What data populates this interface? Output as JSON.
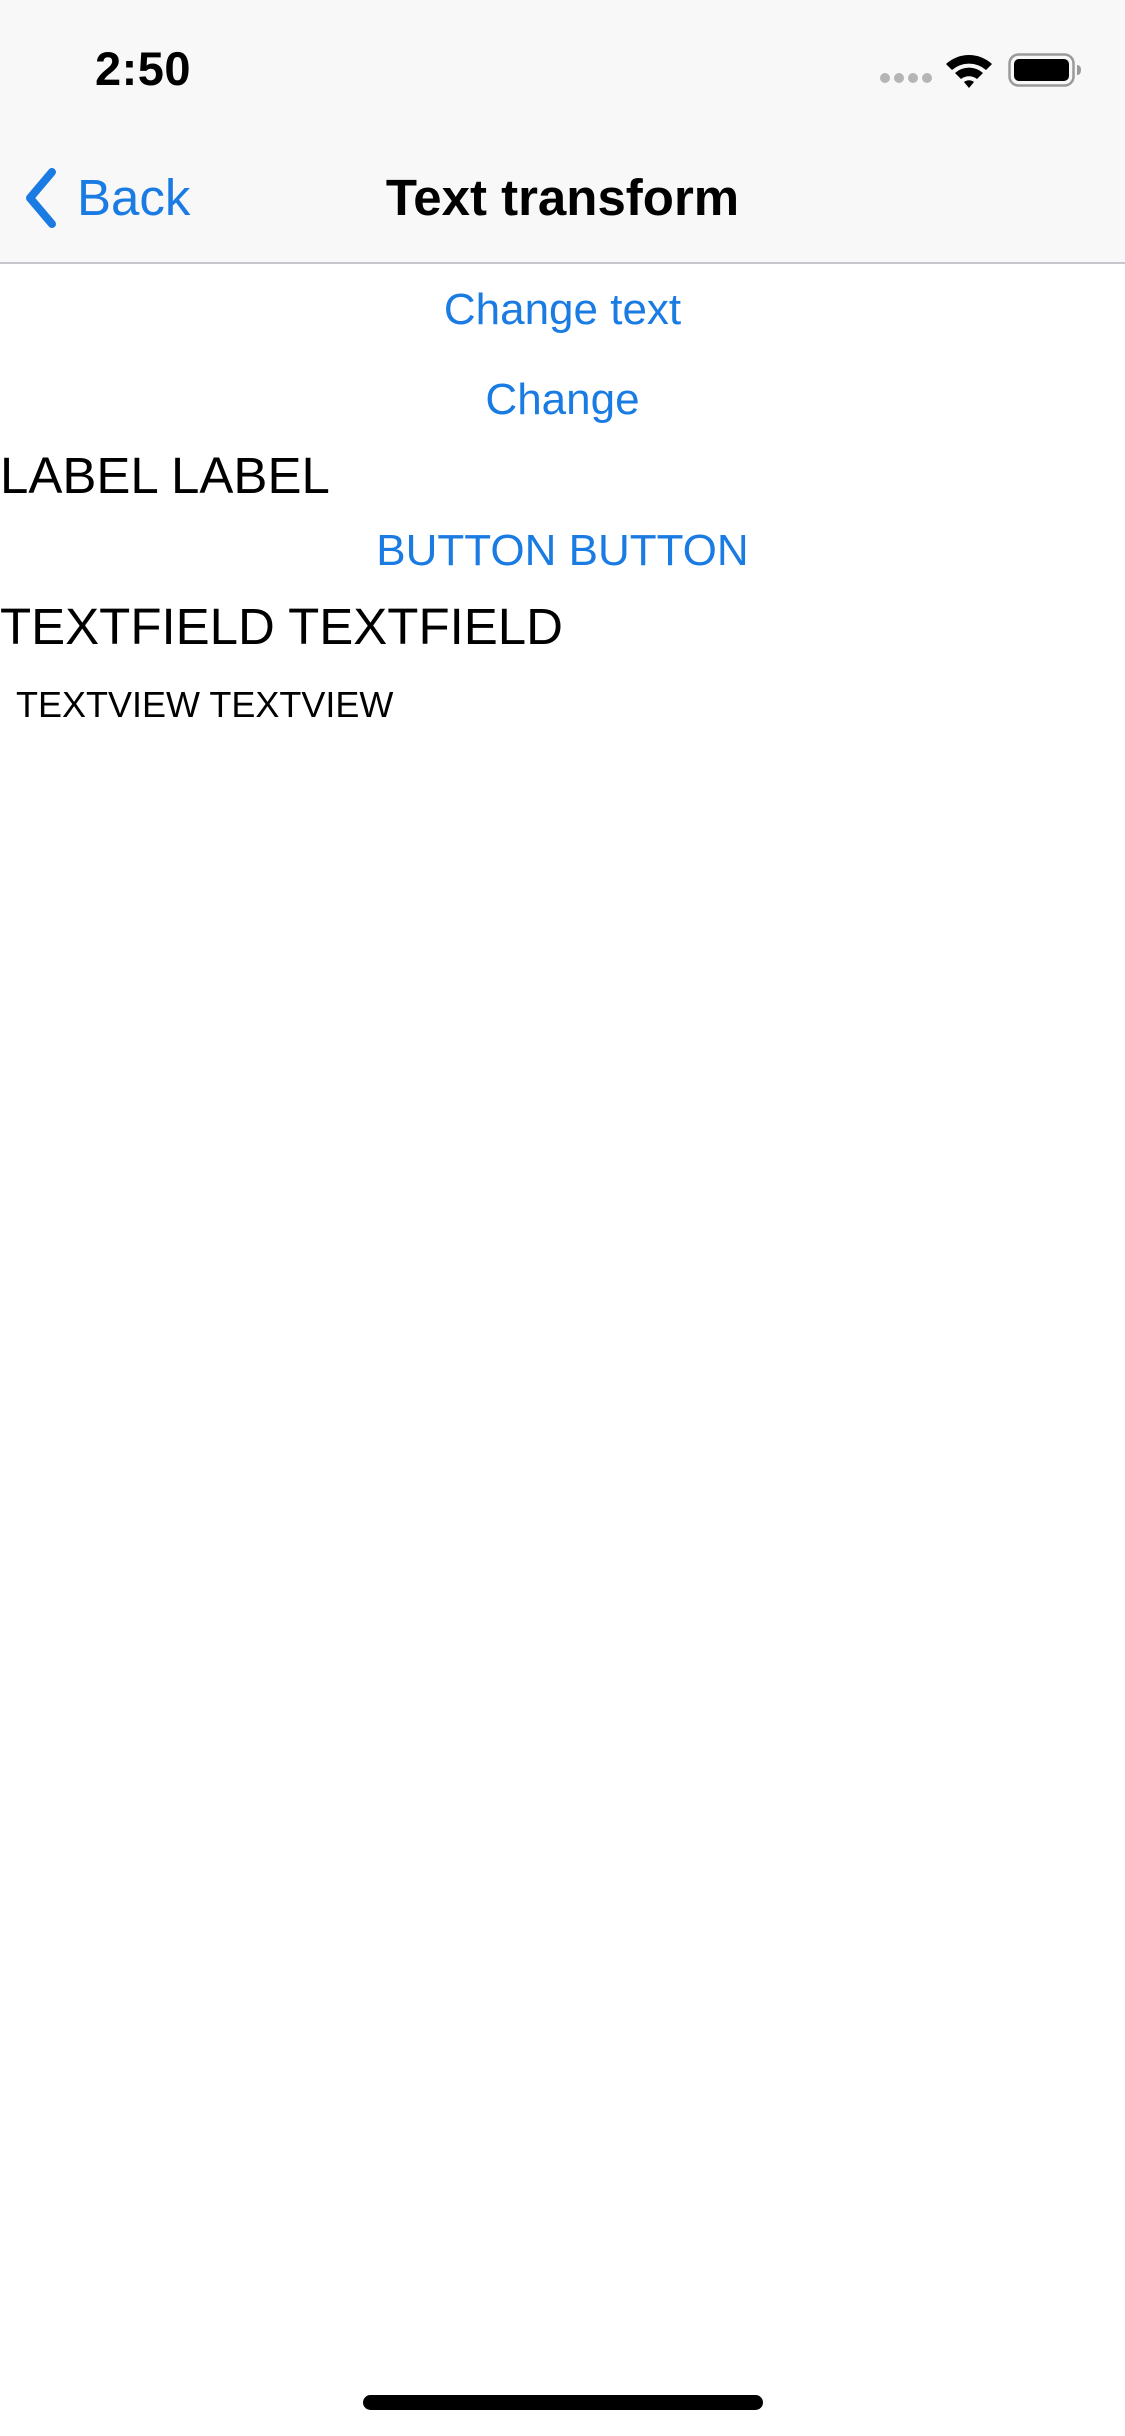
{
  "status_bar": {
    "time": "2:50"
  },
  "navigation": {
    "back_label": "Back",
    "title": "Text transform"
  },
  "content": {
    "change_text_button": "Change text",
    "change_button": "Change",
    "label_text": "LABEL LABEL",
    "transform_button": "BUTTON BUTTON",
    "textfield_text": "TEXTFIELD TEXTFIELD",
    "textview_text": "TEXTVIEW TEXTVIEW"
  },
  "colors": {
    "accent": "#1a7be3",
    "bar_background": "#f8f8f8",
    "text": "#000000"
  }
}
